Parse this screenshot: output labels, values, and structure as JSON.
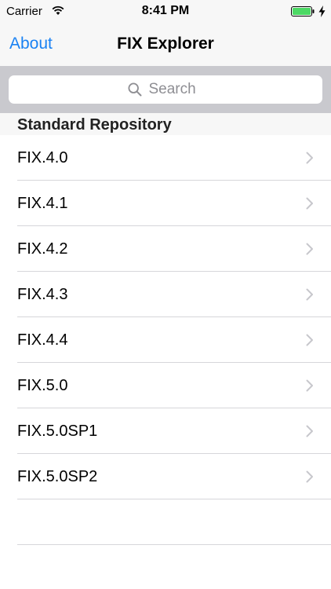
{
  "status_bar": {
    "carrier": "Carrier",
    "time": "8:41 PM",
    "wifi_icon": "wifi-icon",
    "battery_icon": "battery-icon",
    "battery_color": "#4cd964"
  },
  "nav": {
    "back_label": "About",
    "title": "FIX Explorer",
    "accent_color": "#1a82f3"
  },
  "search": {
    "placeholder": "Search",
    "icon": "search-icon"
  },
  "section": {
    "title": "Standard Repository"
  },
  "list": {
    "items": [
      {
        "label": "FIX.4.0"
      },
      {
        "label": "FIX.4.1"
      },
      {
        "label": "FIX.4.2"
      },
      {
        "label": "FIX.4.3"
      },
      {
        "label": "FIX.4.4"
      },
      {
        "label": "FIX.5.0"
      },
      {
        "label": "FIX.5.0SP1"
      },
      {
        "label": "FIX.5.0SP2"
      }
    ],
    "chevron_icon": "chevron-right-icon"
  }
}
